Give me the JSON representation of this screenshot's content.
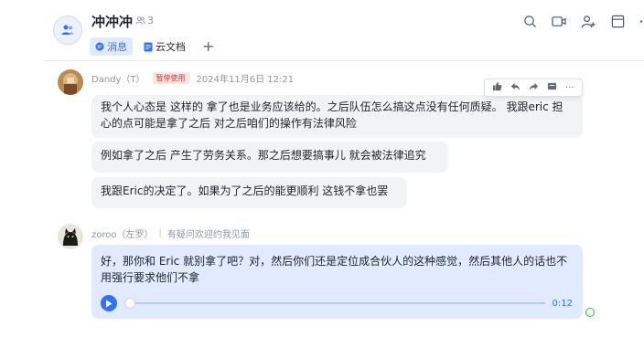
{
  "header": {
    "title": "冲冲冲",
    "member_count": "3",
    "tabs": [
      {
        "label": "消息",
        "icon": "chat-bubble-icon"
      },
      {
        "label": "云文档",
        "icon": "document-icon"
      }
    ],
    "add_tab_label": "+",
    "tools": [
      "search-icon",
      "video-call-icon",
      "add-member-icon",
      "window-icon",
      "more-icon"
    ]
  },
  "toolbar": {
    "items": [
      "thumbs-up-icon",
      "reply-icon",
      "forward-icon",
      "pin-icon",
      "more-icon"
    ],
    "more_label": "···"
  },
  "messages": [
    {
      "sender": "Dandy（T）",
      "status_tag": "暂停使用",
      "time": "2024年11月6日 12:21",
      "bubbles": [
        "我个人心态是 这样的 拿了也是业务应该给的。之后队伍怎么搞这点没有任何质疑。 我跟eric 担心的点可能是拿了之后 对之后咱们的操作有法律风险",
        "例如拿了之后 产生了劳务关系。那之后想要搞事儿 就会被法律追究",
        "我跟Eric的决定了。如果为了之后的能更顺利 这钱不拿也罢"
      ]
    },
    {
      "sender": "zoroo（左罗）",
      "signature": "有疑问欢迎约我见面",
      "bubbles": [
        "好，那你和 Eric 就别拿了吧？对，然后你们还是定位成合伙人的这种感觉，然后其他人的话也不用强行要求他们不拿"
      ],
      "audio": {
        "duration": "0:12",
        "progress": 0
      }
    }
  ],
  "colors": {
    "accent": "#3370ff",
    "bubble_gray": "#f2f3f5",
    "bubble_blue": "#e1eaff",
    "tag_red": "#d83931"
  }
}
